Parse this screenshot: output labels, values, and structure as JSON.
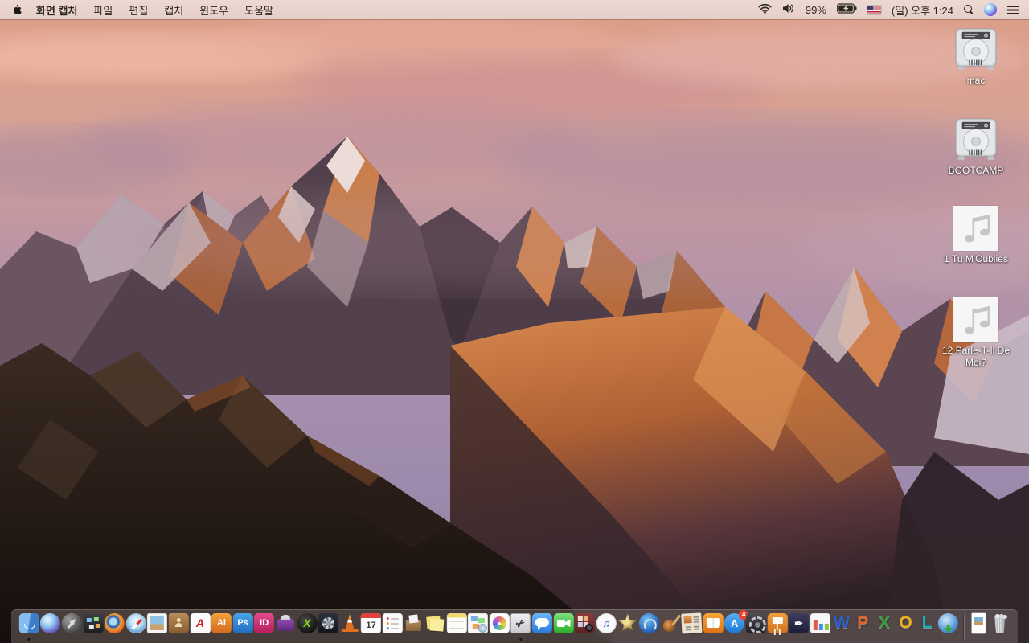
{
  "menu_bar": {
    "app_name": "화면 캡처",
    "menus": [
      {
        "name": "menu-file",
        "label": "파일"
      },
      {
        "name": "menu-edit",
        "label": "편집"
      },
      {
        "name": "menu-capture",
        "label": "캡처"
      },
      {
        "name": "menu-window",
        "label": "윈도우"
      },
      {
        "name": "menu-help",
        "label": "도움말"
      }
    ],
    "status": {
      "battery_percent": "99%",
      "clock": "(일) 오후 1:24"
    }
  },
  "desktop": {
    "icons": [
      {
        "name": "mac-drive",
        "label": "mac",
        "type": "drive"
      },
      {
        "name": "bootcamp-drive",
        "label": "BOOTCAMP",
        "type": "drive"
      },
      {
        "name": "audio-file-tu-moublies",
        "label": "1 Tu M'Oublies",
        "type": "audio"
      },
      {
        "name": "audio-file-parle-t-il-de-moi",
        "label": "12 Parle-T-Il De Moi?",
        "type": "audio"
      }
    ]
  },
  "dock": {
    "items": [
      {
        "id": "finder",
        "name": "finder",
        "running": true
      },
      {
        "id": "siri",
        "name": "siri"
      },
      {
        "id": "launchpad",
        "name": "launchpad"
      },
      {
        "id": "missionctl",
        "name": "mission-control"
      },
      {
        "id": "firefox",
        "name": "firefox"
      },
      {
        "id": "safari",
        "name": "safari"
      },
      {
        "id": "preview",
        "name": "preview"
      },
      {
        "id": "contacts",
        "name": "contacts"
      },
      {
        "id": "acrobat",
        "name": "adobe-acrobat",
        "glyph": "A"
      },
      {
        "id": "illustrator",
        "name": "adobe-illustrator",
        "glyph": "Ai"
      },
      {
        "id": "photoshop",
        "name": "adobe-photoshop",
        "glyph": "Ps"
      },
      {
        "id": "indesign",
        "name": "adobe-indesign",
        "glyph": "ID"
      },
      {
        "id": "toast",
        "name": "toast-burner"
      },
      {
        "id": "xapp",
        "name": "x-green-app",
        "glyph": "X"
      },
      {
        "id": "fandisk",
        "name": "disk-fan-app"
      },
      {
        "id": "vlc",
        "name": "vlc"
      },
      {
        "id": "calendar",
        "name": "calendar",
        "glyph": "17"
      },
      {
        "id": "reminders",
        "name": "reminders"
      },
      {
        "id": "archivebox",
        "name": "archive-box-app"
      },
      {
        "id": "stickies",
        "name": "stickies"
      },
      {
        "id": "notes",
        "name": "notes"
      },
      {
        "id": "webpages",
        "name": "web-pages-app"
      },
      {
        "id": "photos",
        "name": "photos"
      },
      {
        "id": "grab",
        "name": "grab-screen-capture",
        "glyph": "✂",
        "running": true
      },
      {
        "id": "messages",
        "name": "messages"
      },
      {
        "id": "facetime",
        "name": "facetime"
      },
      {
        "id": "photobooth",
        "name": "photo-booth"
      },
      {
        "id": "itunes",
        "name": "itunes",
        "glyph": "♫"
      },
      {
        "id": "imovie",
        "name": "imovie"
      },
      {
        "id": "idvd",
        "name": "idvd"
      },
      {
        "id": "garageband",
        "name": "garageband"
      },
      {
        "id": "newsletter",
        "name": "newsletter-app"
      },
      {
        "id": "ibooks",
        "name": "ibooks"
      },
      {
        "id": "appstore",
        "name": "app-store",
        "glyph": "A",
        "badge": "4"
      },
      {
        "id": "sysprefs",
        "name": "system-preferences"
      },
      {
        "id": "keynote",
        "name": "keynote"
      },
      {
        "id": "pages",
        "name": "pages",
        "glyph": "✒"
      },
      {
        "id": "numbers",
        "name": "numbers"
      },
      {
        "id": "word",
        "name": "ms-word",
        "glyph": "W"
      },
      {
        "id": "powerpoint",
        "name": "ms-powerpoint",
        "glyph": "P"
      },
      {
        "id": "excel",
        "name": "ms-excel",
        "glyph": "X"
      },
      {
        "id": "outlook",
        "name": "ms-outlook",
        "glyph": "O"
      },
      {
        "id": "lync",
        "name": "ms-lync",
        "glyph": "L"
      },
      {
        "id": "downloader",
        "name": "download-globe-app"
      },
      {
        "id": "divider",
        "name": "dock-divider"
      },
      {
        "id": "docfile",
        "name": "document-file"
      },
      {
        "id": "trash",
        "name": "trash"
      }
    ]
  },
  "colors": {
    "menubar_bg": "#e9d6cf",
    "dock_bg": "rgba(116,106,102,0.52)",
    "sunlit_rock": "#c97a46",
    "sky_top": "#dc9c84"
  }
}
